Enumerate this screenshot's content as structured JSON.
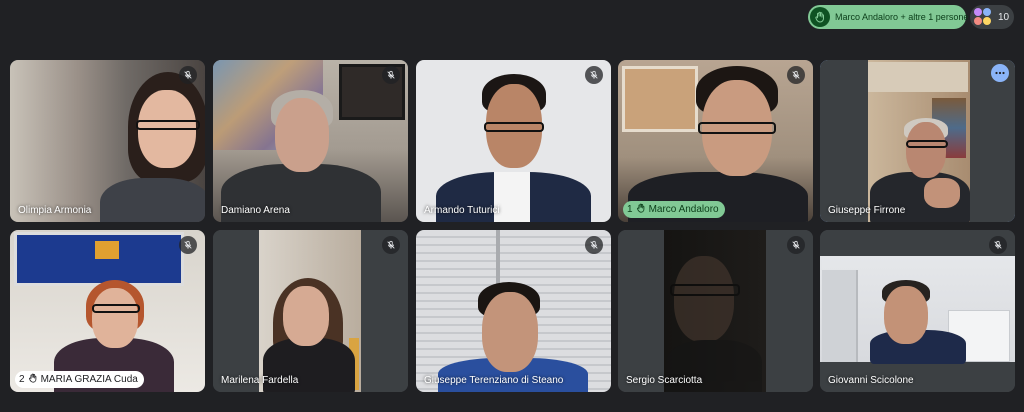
{
  "top": {
    "raised_hands_text": "Marco Andaloro + altre 1 persone",
    "participant_count": "10"
  },
  "tiles": [
    {
      "name": "Olimpia Armonia",
      "muted": true
    },
    {
      "name": "Damiano Arena",
      "muted": true
    },
    {
      "name": "Armando Tuturici",
      "muted": true
    },
    {
      "name": "Marco Andaloro",
      "muted": true,
      "hand_order": "1"
    },
    {
      "name": "Giuseppe Firrone",
      "muted": false,
      "active": true
    },
    {
      "name": "MARIA GRAZIA Cuda",
      "muted": true,
      "hand_order": "2"
    },
    {
      "name": "Marilena Fardella",
      "muted": true
    },
    {
      "name": "Giuseppe Terenziano di Steano",
      "muted": true
    },
    {
      "name": "Sergio Scarciotta",
      "muted": true
    },
    {
      "name": "Giovanni Scicolone",
      "muted": true
    }
  ],
  "icons": {
    "mic_off": "mic-off-icon",
    "hand": "raised-hand-icon",
    "more": "more-options-icon"
  },
  "colors": {
    "background": "#202124",
    "hand_pill": "#81c995",
    "active_border": "#8ab4f8"
  }
}
